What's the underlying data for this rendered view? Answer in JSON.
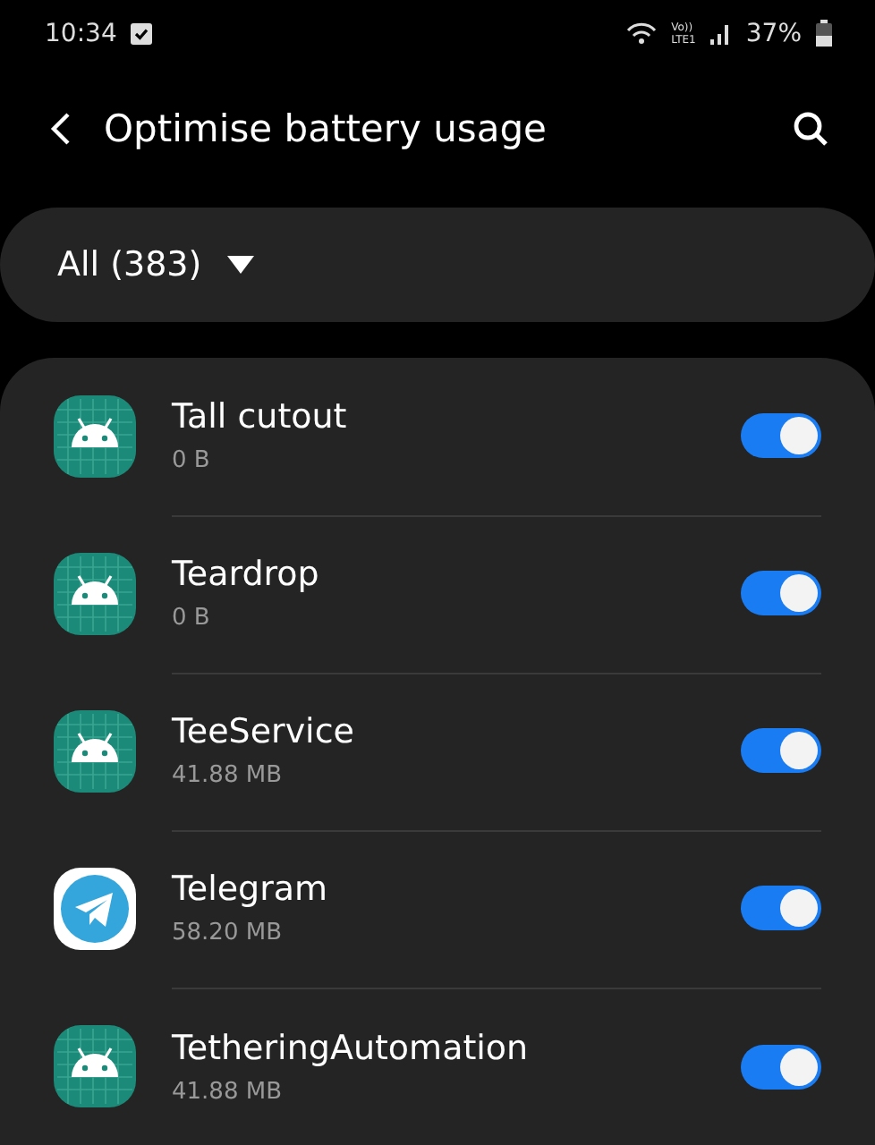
{
  "status_bar": {
    "time": "10:34",
    "network_label": [
      "Vo))",
      "LTE1"
    ],
    "battery": "37%"
  },
  "header": {
    "title": "Optimise battery usage"
  },
  "filter": {
    "label": "All (383)"
  },
  "apps": [
    {
      "name": "Tall cutout",
      "size": "0 B",
      "kind": "android",
      "on": true
    },
    {
      "name": "Teardrop",
      "size": "0 B",
      "kind": "android",
      "on": true
    },
    {
      "name": "TeeService",
      "size": "41.88 MB",
      "kind": "android",
      "on": true
    },
    {
      "name": "Telegram",
      "size": "58.20 MB",
      "kind": "telegram",
      "on": true
    },
    {
      "name": "TetheringAutomation",
      "size": "41.88 MB",
      "kind": "android",
      "on": true
    }
  ]
}
